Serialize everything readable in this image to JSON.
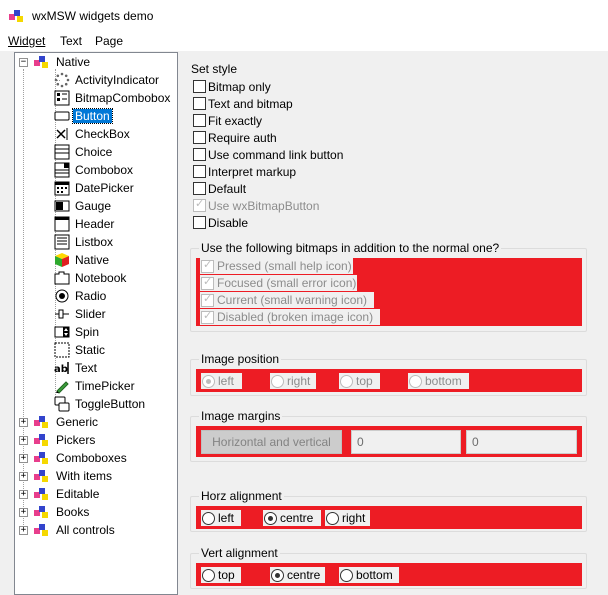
{
  "window": {
    "title": "wxMSW widgets demo"
  },
  "menu": [
    "Widget",
    "Text",
    "Page"
  ],
  "tree": {
    "root": "Native",
    "children": [
      "ActivityIndicator",
      "BitmapCombobox",
      "Button",
      "CheckBox",
      "Choice",
      "Combobox",
      "DatePicker",
      "Gauge",
      "Header",
      "Listbox",
      "Native",
      "Notebook",
      "Radio",
      "Slider",
      "Spin",
      "Static",
      "Text",
      "TimePicker",
      "ToggleButton"
    ],
    "selected": "Button",
    "collapsed": [
      "Generic",
      "Pickers",
      "Comboboxes",
      "With items",
      "Editable",
      "Books",
      "All controls"
    ]
  },
  "set_style": {
    "title": "Set style",
    "options": [
      {
        "label": "Bitmap only",
        "checked": false,
        "disabled": false
      },
      {
        "label": "Text and bitmap",
        "checked": false,
        "disabled": false
      },
      {
        "label": "Fit exactly",
        "checked": false,
        "disabled": false
      },
      {
        "label": "Require auth",
        "checked": false,
        "disabled": false
      },
      {
        "label": "Use command link button",
        "checked": false,
        "disabled": false
      },
      {
        "label": "Interpret markup",
        "checked": false,
        "disabled": false
      },
      {
        "label": "Default",
        "checked": false,
        "disabled": false
      },
      {
        "label": "Use wxBitmapButton",
        "checked": true,
        "disabled": true
      },
      {
        "label": "Disable",
        "checked": false,
        "disabled": false
      }
    ]
  },
  "bitmaps": {
    "title": "Use the following bitmaps in addition to the normal one?",
    "options": [
      "Pressed (small help icon)",
      "Focused (small error icon)",
      "Current (small warning icon)",
      "Disabled (broken image icon)"
    ]
  },
  "image_position": {
    "title": "Image position",
    "options": [
      "left",
      "right",
      "top",
      "bottom"
    ],
    "selected": "left"
  },
  "image_margins": {
    "title": "Image margins",
    "button": "Horizontal and vertical",
    "value1": "0",
    "value2": "0"
  },
  "horz_alignment": {
    "title": "Horz alignment",
    "options": [
      "left",
      "centre",
      "right"
    ],
    "selected": "centre"
  },
  "vert_alignment": {
    "title": "Vert alignment",
    "options": [
      "top",
      "centre",
      "bottom"
    ],
    "selected": "centre"
  },
  "colors": {
    "highlight": "#ed1c24",
    "selection": "#0078d7"
  }
}
